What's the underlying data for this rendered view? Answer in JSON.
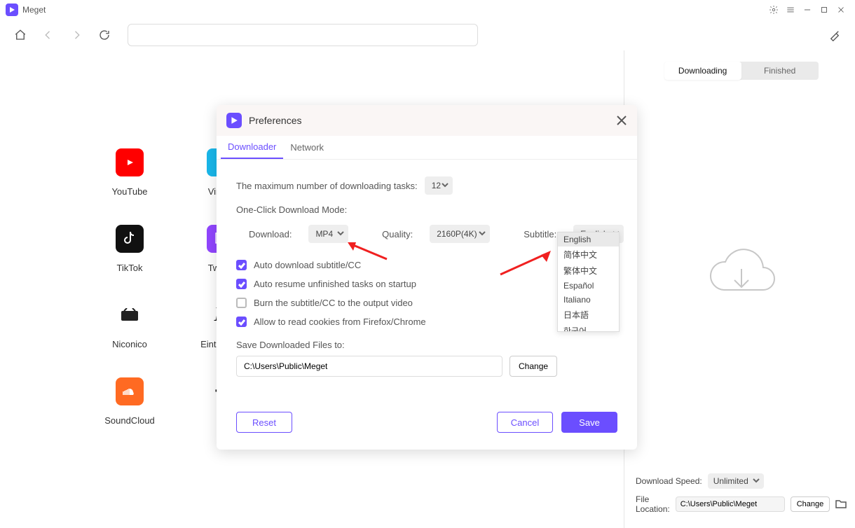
{
  "app": {
    "title": "Meget"
  },
  "titlebar": {},
  "toolbar": {
    "url": ""
  },
  "sites": [
    {
      "key": "youtube",
      "label": "YouTube",
      "bg": "#ff0000"
    },
    {
      "key": "vimeo",
      "label": "Vimeo",
      "bg": "#19b7ea"
    },
    {
      "key": "tiktok",
      "label": "TikTok",
      "bg": "#111"
    },
    {
      "key": "twitch",
      "label": "Twitch",
      "bg": "#9146ff"
    },
    {
      "key": "niconico",
      "label": "Niconico",
      "bg": "#222"
    },
    {
      "key": "einthusan",
      "label": "Einthusan",
      "bg": "#fff"
    },
    {
      "key": "soundcloud",
      "label": "SoundCloud",
      "bg": "#ff6a22"
    },
    {
      "key": "add",
      "label": "",
      "bg": "#fff"
    }
  ],
  "right": {
    "tabs": {
      "downloading": "Downloading",
      "finished": "Finished",
      "active": "downloading"
    },
    "speed_label": "Download Speed:",
    "speed_value": "Unlimited",
    "loc_label": "File Location:",
    "loc_value": "C:\\Users\\Public\\Meget",
    "change": "Change"
  },
  "dialog": {
    "title": "Preferences",
    "tabs": {
      "downloader": "Downloader",
      "network": "Network"
    },
    "max_tasks_label": "The maximum number of downloading tasks:",
    "max_tasks_value": "12",
    "mode_label": "One-Click Download Mode:",
    "download_label": "Download:",
    "download_value": "MP4",
    "quality_label": "Quality:",
    "quality_value": "2160P(4K)",
    "subtitle_label": "Subtitle:",
    "subtitle_value": "English",
    "subtitle_options": [
      "English",
      "简体中文",
      "繁体中文",
      "Español",
      "Italiano",
      "日本語",
      "한국어"
    ],
    "cb_auto_sub": "Auto download subtitle/CC",
    "cb_auto_resume": "Auto resume unfinished tasks on startup",
    "cb_burn": "Burn the subtitle/CC to the output video",
    "cb_cookies": "Allow to read cookies from Firefox/Chrome",
    "save_to_label": "Save Downloaded Files to:",
    "save_to_value": "C:\\Users\\Public\\Meget",
    "change": "Change",
    "reset": "Reset",
    "cancel": "Cancel",
    "save": "Save"
  }
}
